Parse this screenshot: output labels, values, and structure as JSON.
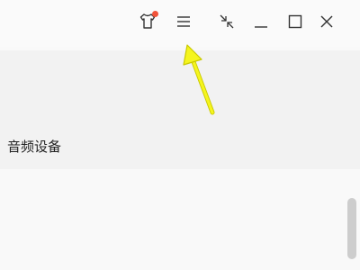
{
  "titlebar": {
    "buttons": [
      {
        "name": "skin",
        "icon": "tshirt-icon",
        "has_badge": true
      },
      {
        "name": "menu",
        "icon": "hamburger-menu-icon"
      },
      {
        "name": "mini-mode",
        "icon": "collapse-arrows-icon"
      },
      {
        "name": "minimize",
        "icon": "minimize-icon"
      },
      {
        "name": "maximize",
        "icon": "maximize-icon"
      },
      {
        "name": "close",
        "icon": "close-icon"
      }
    ]
  },
  "colors": {
    "icon": "#333333",
    "badge": "#f0533a",
    "annotation_arrow": "#f5f51e",
    "annotation_outline": "#c9c900"
  },
  "section": {
    "label": "音频设备"
  }
}
